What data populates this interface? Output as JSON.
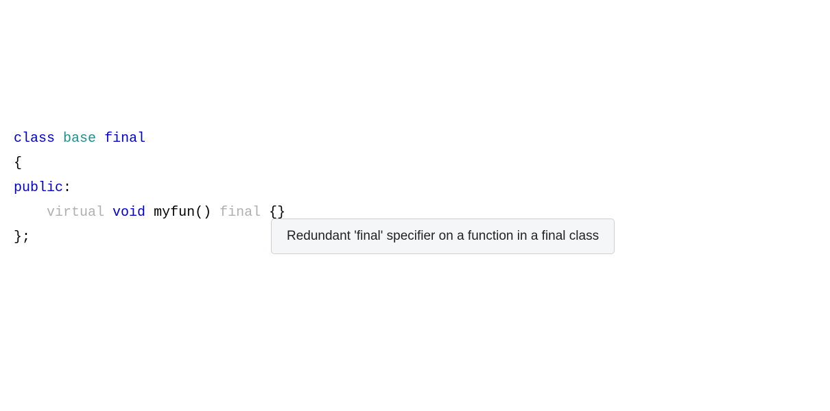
{
  "code": {
    "line1": {
      "class_kw": "class",
      "class_name": "base",
      "final_kw": "final"
    },
    "line2": {
      "brace_open": "{"
    },
    "line3": {
      "access": "public",
      "colon": ":"
    },
    "line4": {
      "indent": "    ",
      "virtual_kw": "virtual",
      "void_kw": "void",
      "fn_name": "myfun",
      "parens": "()",
      "final_kw": "final",
      "body": "{}"
    },
    "line5": {
      "brace_close": "};"
    }
  },
  "tooltip": {
    "message": "Redundant 'final' specifier on a function in a final class"
  }
}
